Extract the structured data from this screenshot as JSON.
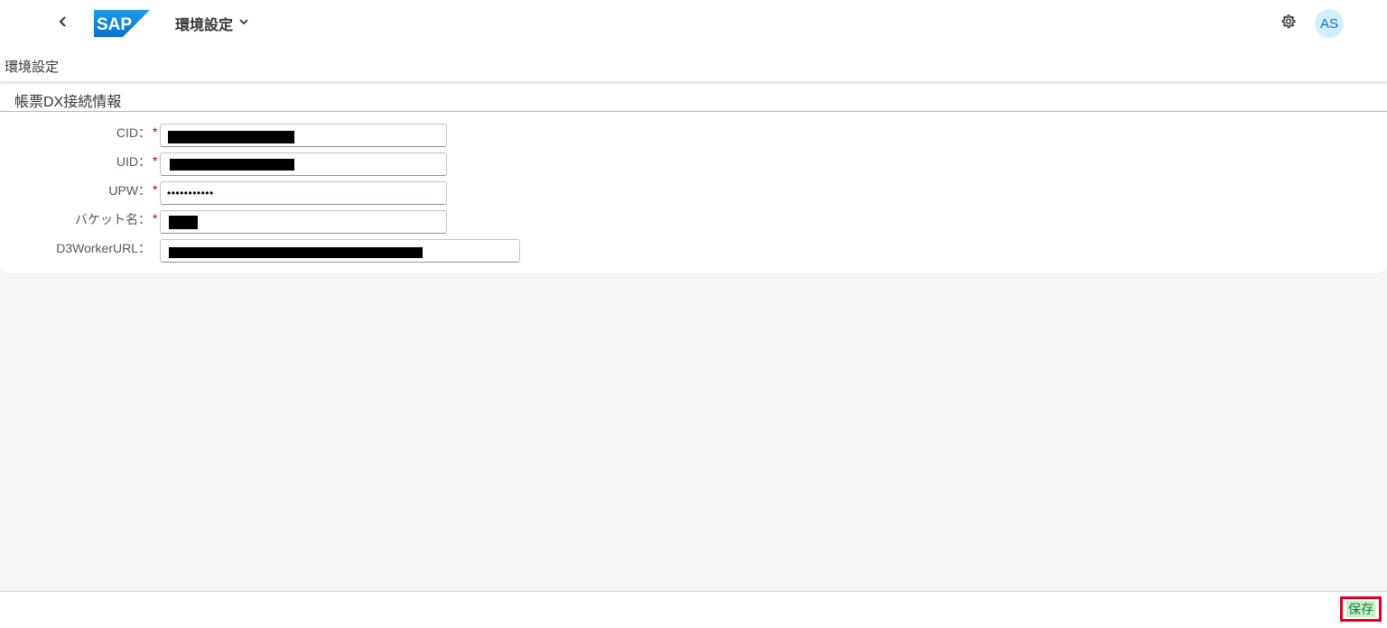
{
  "shell": {
    "logo_text": "SAP",
    "app_title": "環境設定",
    "avatar_initials": "AS",
    "icons": {
      "back": "chevron-left-icon",
      "title_menu": "chevron-down-icon",
      "settings": "gear-icon"
    },
    "colors": {
      "logo_blue": "#0a6ed1",
      "avatar_bg": "#d1efff"
    }
  },
  "page": {
    "title": "環境設定"
  },
  "panel": {
    "title": "帳票DX接続情報",
    "fields": [
      {
        "label": "CID：",
        "required_mark": "*",
        "value": ""
      },
      {
        "label": "UID：",
        "required_mark": "*",
        "value": ""
      },
      {
        "label": "UPW：",
        "required_mark": "*",
        "value": "•••••••••••"
      },
      {
        "label": "バケット名：",
        "required_mark": "*",
        "value": ""
      },
      {
        "label": "D3WorkerURL：",
        "value": ""
      }
    ]
  },
  "footer": {
    "save_label": "保存",
    "colors": {
      "save_bg": "#c7f2c9",
      "save_text": "#107e3e",
      "highlight_border": "#e0001b"
    }
  }
}
